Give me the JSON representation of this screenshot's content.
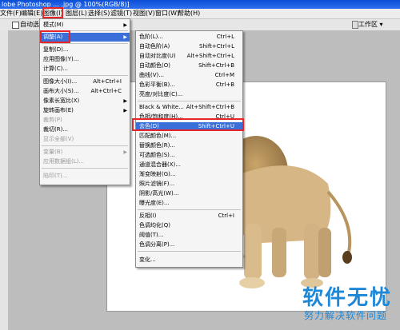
{
  "titlebar": {
    "text": "lobe Photoshop ... .jpg @ 100%(RGB/8)]"
  },
  "menubar": {
    "items": [
      "文件(F)",
      "编辑(E)",
      "图像(I)",
      "图层(L)",
      "选择(S)",
      "滤镜(T)",
      "视图(V)",
      "窗口(W)",
      "帮助(H)"
    ],
    "right_label": "工作区 ▾"
  },
  "optionsbar": {
    "auto_select": "自动选择"
  },
  "image_menu": {
    "items": [
      {
        "label": "模式(M)",
        "shortcut": ""
      },
      {
        "label": "调整(A)",
        "shortcut": ""
      },
      {
        "label": "复制(D)...",
        "shortcut": ""
      },
      {
        "label": "应用图像(Y)...",
        "shortcut": ""
      },
      {
        "label": "计算(C)...",
        "shortcut": ""
      },
      {
        "label": "图像大小(I)...",
        "shortcut": "Alt+Ctrl+I"
      },
      {
        "label": "画布大小(S)...",
        "shortcut": "Alt+Ctrl+C"
      },
      {
        "label": "像素长宽比(X)",
        "shortcut": ""
      },
      {
        "label": "旋转画布(E)",
        "shortcut": ""
      },
      {
        "label": "裁剪(P)",
        "shortcut": ""
      },
      {
        "label": "裁切(R)...",
        "shortcut": ""
      },
      {
        "label": "显示全部(V)",
        "shortcut": ""
      },
      {
        "label": "变量(B)",
        "shortcut": ""
      },
      {
        "label": "应用数据组(L)...",
        "shortcut": ""
      },
      {
        "label": "陷印(T)...",
        "shortcut": ""
      }
    ]
  },
  "adjust_menu": {
    "items": [
      {
        "label": "色阶(L)...",
        "shortcut": "Ctrl+L"
      },
      {
        "label": "自动色阶(A)",
        "shortcut": "Shift+Ctrl+L"
      },
      {
        "label": "自动对比度(U)",
        "shortcut": "Alt+Shift+Ctrl+L"
      },
      {
        "label": "自动颜色(O)",
        "shortcut": "Shift+Ctrl+B"
      },
      {
        "label": "曲线(V)...",
        "shortcut": "Ctrl+M"
      },
      {
        "label": "色彩平衡(B)...",
        "shortcut": "Ctrl+B"
      },
      {
        "label": "亮度/对比度(C)...",
        "shortcut": ""
      },
      {
        "label": "Black & White...",
        "shortcut": "Alt+Shift+Ctrl+B"
      },
      {
        "label": "色相/饱和度(H)...",
        "shortcut": "Ctrl+U"
      },
      {
        "label": "去色(D)",
        "shortcut": "Shift+Ctrl+U"
      },
      {
        "label": "匹配颜色(M)...",
        "shortcut": ""
      },
      {
        "label": "替换颜色(R)...",
        "shortcut": ""
      },
      {
        "label": "可选颜色(S)...",
        "shortcut": ""
      },
      {
        "label": "通道混合器(X)...",
        "shortcut": ""
      },
      {
        "label": "渐变映射(G)...",
        "shortcut": ""
      },
      {
        "label": "照片滤镜(F)...",
        "shortcut": ""
      },
      {
        "label": "阴影/高光(W)...",
        "shortcut": ""
      },
      {
        "label": "曝光度(E)...",
        "shortcut": ""
      },
      {
        "label": "反相(I)",
        "shortcut": "Ctrl+I"
      },
      {
        "label": "色调均化(Q)",
        "shortcut": ""
      },
      {
        "label": "阈值(T)...",
        "shortcut": ""
      },
      {
        "label": "色调分离(P)...",
        "shortcut": ""
      },
      {
        "label": "变化...",
        "shortcut": ""
      }
    ]
  },
  "watermark": {
    "title": "软件无忧",
    "subtitle": "努力解决软件问题"
  },
  "colors": {
    "highlight": "#3a6ed8",
    "annotation_red": "#e8262a",
    "watermark": "#1e88d8"
  }
}
